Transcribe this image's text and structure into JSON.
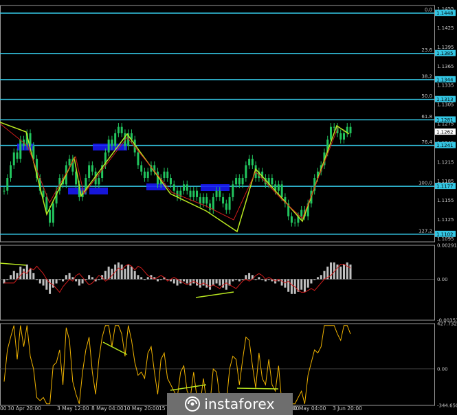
{
  "chart_data": [
    {
      "type": "line",
      "panel": "price",
      "y_labels": [
        "1.1455",
        "1.1448",
        "1.1425",
        "1.1395",
        "1.1365",
        "1.1344",
        "1.1335",
        "1.1313",
        "1.1305",
        "1.1281",
        "1.1275",
        "1.1262",
        "1.1245",
        "1.1241",
        "1.1215",
        "1.1185",
        "1.1177",
        "1.1155",
        "1.1125",
        "1.1102",
        "1.1095"
      ],
      "ylim": [
        1.109,
        1.146
      ],
      "fib_levels": [
        {
          "pct": "0.0",
          "value": 1.1448,
          "label": "1.1448"
        },
        {
          "pct": "23.6",
          "value": 1.1385,
          "label": "1.1385"
        },
        {
          "pct": "38.2",
          "value": 1.1344,
          "label": "1.1344"
        },
        {
          "pct": "50.0",
          "value": 1.1313,
          "label": "1.1313"
        },
        {
          "pct": "61.8",
          "value": 1.1281,
          "label": "1.1281"
        },
        {
          "pct": "76.4",
          "value": 1.1241,
          "label": "1.1241"
        },
        {
          "pct": "100.0",
          "value": 1.1177,
          "label": "1.1177"
        },
        {
          "pct": "127.2",
          "value": 1.1102,
          "label": "1.1102"
        }
      ],
      "current_price": "1.1262",
      "close_series": [
        1.117,
        1.119,
        1.121,
        1.123,
        1.122,
        1.125,
        1.124,
        1.126,
        1.124,
        1.122,
        1.119,
        1.117,
        1.116,
        1.114,
        1.112,
        1.115,
        1.117,
        1.119,
        1.118,
        1.121,
        1.122,
        1.12,
        1.118,
        1.116,
        1.117,
        1.119,
        1.121,
        1.12,
        1.118,
        1.119,
        1.121,
        1.123,
        1.125,
        1.124,
        1.126,
        1.127,
        1.126,
        1.124,
        1.126,
        1.125,
        1.123,
        1.121,
        1.12,
        1.119,
        1.12,
        1.121,
        1.12,
        1.118,
        1.119,
        1.12,
        1.119,
        1.118,
        1.117,
        1.116,
        1.117,
        1.118,
        1.117,
        1.116,
        1.117,
        1.116,
        1.115,
        1.116,
        1.115,
        1.114,
        1.116,
        1.117,
        1.116,
        1.115,
        1.114,
        1.116,
        1.118,
        1.119,
        1.118,
        1.119,
        1.121,
        1.122,
        1.121,
        1.119,
        1.12,
        1.119,
        1.118,
        1.119,
        1.118,
        1.117,
        1.118,
        1.116,
        1.115,
        1.113,
        1.112,
        1.112,
        1.113,
        1.114,
        1.113,
        1.115,
        1.117,
        1.119,
        1.12,
        1.121,
        1.123,
        1.125,
        1.127,
        1.127,
        1.126,
        1.125,
        1.126,
        1.127,
        1.126
      ]
    },
    {
      "type": "bar",
      "panel": "macd",
      "y_labels": [
        "0.00291",
        "0.00",
        "-0.00351"
      ],
      "ylim": [
        -0.00351,
        0.00291
      ]
    },
    {
      "type": "line",
      "panel": "oscillator",
      "y_labels": [
        "427.7324",
        "0.00",
        "-344.6501"
      ],
      "ylim": [
        -344.6501,
        427.7324
      ]
    }
  ],
  "x_labels": [
    "30 Apr 20:00",
    "3 May 12:00",
    "8 May 04:00",
    "10 May 20:00",
    "15 Ma",
    "30 May 04:00",
    "3 Jun 20:00"
  ],
  "x_edge_labels": [
    "00",
    "00"
  ],
  "watermark": "instaforex",
  "colors": {
    "fib": "#34c8e6",
    "price": "#22c55e",
    "zigzag": "#b8e620",
    "signal": "#d11c1c",
    "osc": "#f2b400",
    "hist": "#c0c0c0",
    "box": "#1a1aff"
  }
}
